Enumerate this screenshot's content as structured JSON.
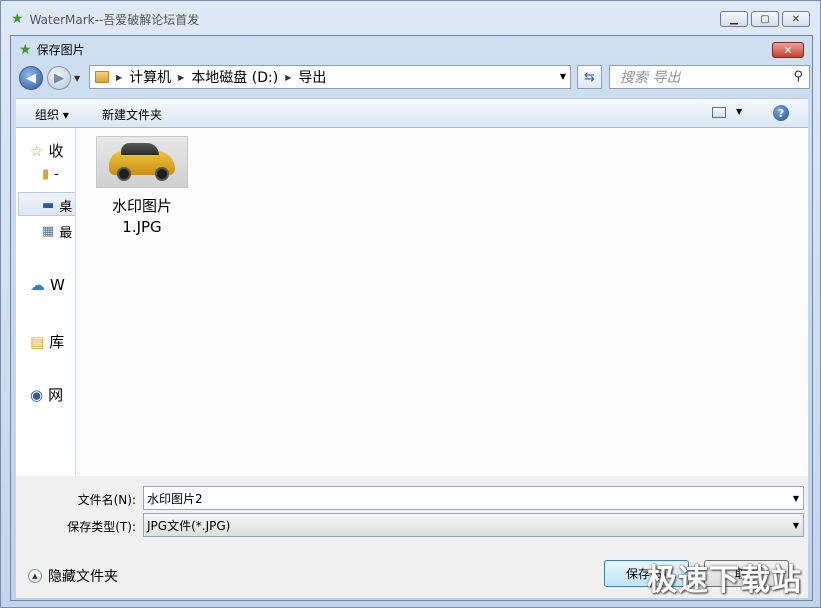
{
  "window": {
    "title": "WaterMark--吾爱破解论坛首发",
    "min": "▭",
    "max": "▣",
    "close": "✕"
  },
  "dialog": {
    "title": "保存图片",
    "close": "✕"
  },
  "address": {
    "crumbs": [
      "计算机",
      "本地磁盘 (D:)",
      "导出"
    ]
  },
  "search": {
    "placeholder": "搜索 导出"
  },
  "toolbar": {
    "organize": "组织 ▾",
    "new_folder": "新建文件夹",
    "help": "?"
  },
  "nav": {
    "favorites": "收",
    "favorites_sub1": "-",
    "favorites_sub2": "桌",
    "favorites_sub3": "最",
    "wps": "W",
    "library": "库",
    "network": "网"
  },
  "files": [
    {
      "name": "水印图片",
      "ext": "1.JPG"
    }
  ],
  "form": {
    "filename_label": "文件名(N):",
    "filename_value": "水印图片2",
    "filetype_label": "保存类型(T):",
    "filetype_value": "JPG文件(*.JPG)"
  },
  "footer": {
    "hide_folders": "隐藏文件夹",
    "save": "保存(S)",
    "cancel": "取消"
  },
  "watermark": "极速下载站",
  "colors": {
    "accent": "#2c5a9c",
    "close_red": "#c4402c"
  }
}
